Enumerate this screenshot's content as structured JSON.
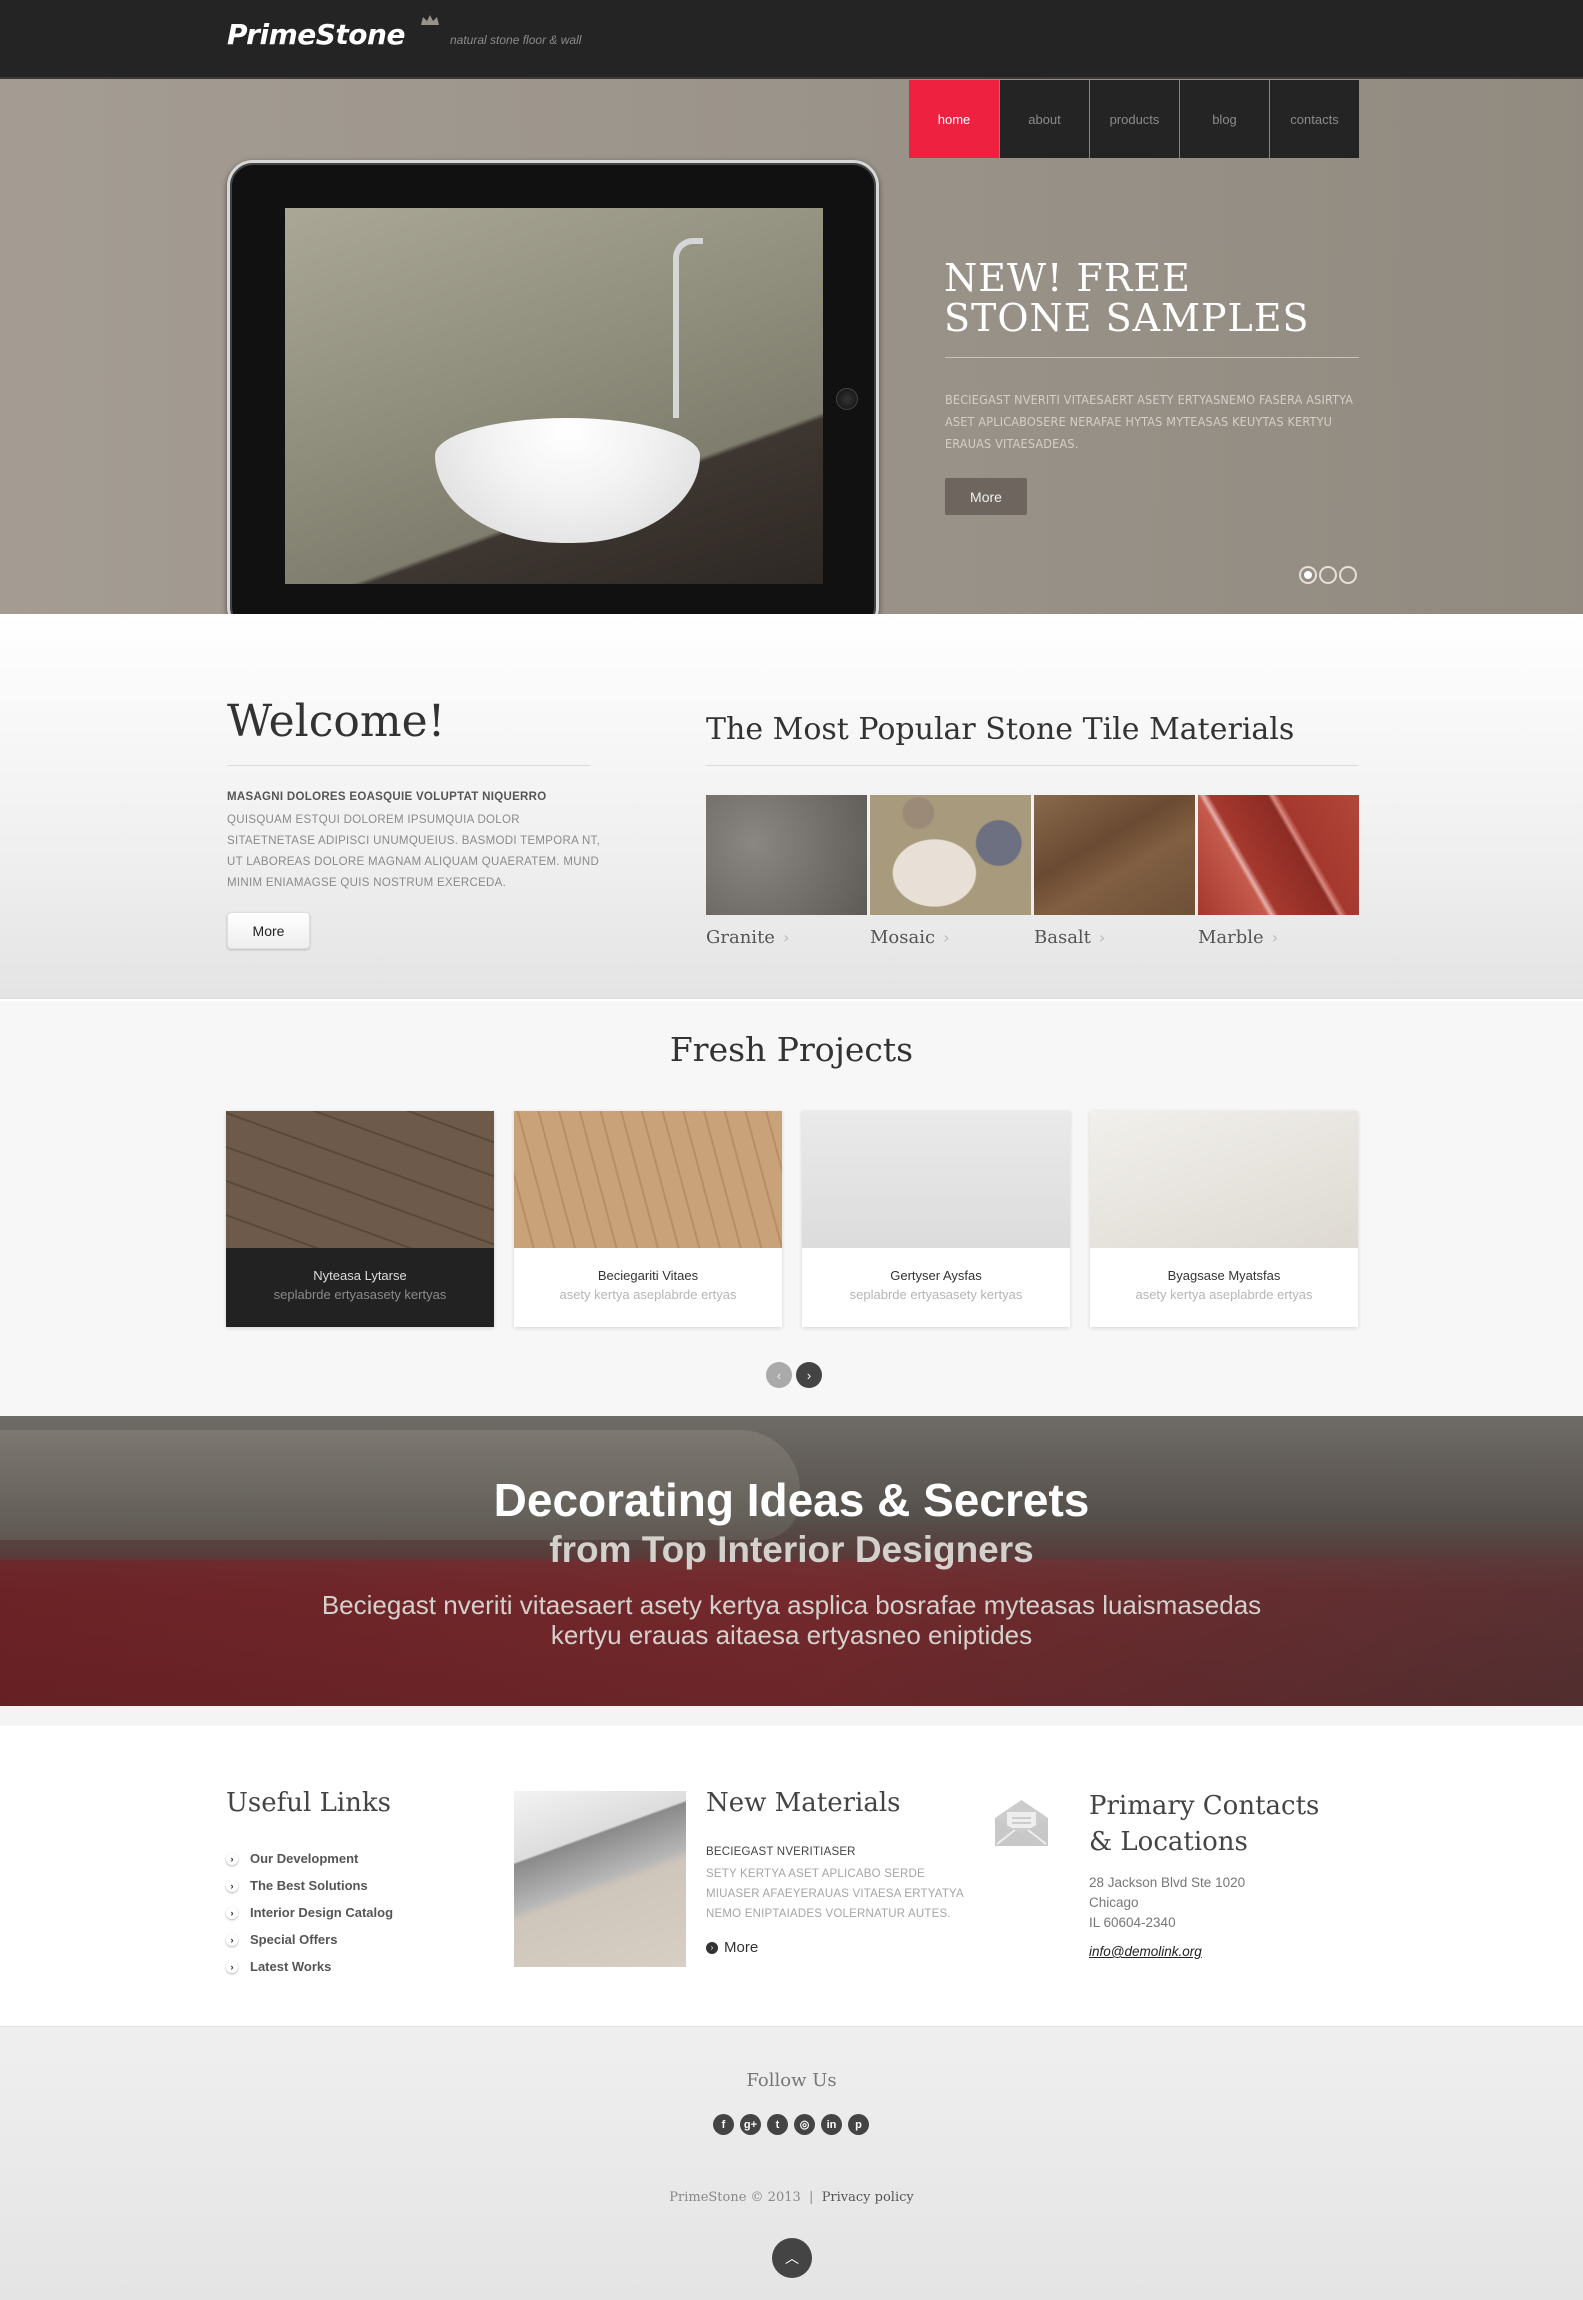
{
  "header": {
    "logo": "PrimeStone",
    "tagline": "natural stone floor & wall",
    "nav": [
      {
        "label": "home",
        "active": true
      },
      {
        "label": "about",
        "active": false
      },
      {
        "label": "products",
        "active": false
      },
      {
        "label": "blog",
        "active": false
      },
      {
        "label": "contacts",
        "active": false
      }
    ]
  },
  "hero": {
    "title_line1": "NEW! FREE",
    "title_line2": "STONE SAMPLES",
    "text": "BECIEGAST NVERITI VITAESAERT ASETY ERTYASNEMO FASERA ASIRTYA ASET APLICABOSERE NERAFAE HYTAS MYTEASAS KEUYTAS KERTYU ERAUAS VITAESADEAS.",
    "more_label": "More",
    "slides": 3,
    "active_slide": 1
  },
  "welcome": {
    "title": "Welcome!",
    "lead": "MASAGNI DOLORES EOASQUIE VOLUPTAT NIQUERRO",
    "text": "QUISQUAM ESTQUI DOLOREM IPSUMQUIA DOLOR SITAETNETASE ADIPISCI UNUMQUEIUS. BASMODI TEMPORA NT, UT LABOREAS DOLORE MAGNAM ALIQUAM QUAERATEM. MUND MINIM ENIAMAGSE QUIS NOSTRUM EXERCEDA.",
    "more_label": "More"
  },
  "materials": {
    "title": "The Most Popular Stone Tile Materials",
    "items": [
      {
        "label": "Granite",
        "color": "#6e6a66"
      },
      {
        "label": "Mosaic",
        "color": "#b7aa8e"
      },
      {
        "label": "Basalt",
        "color": "#7a5a3e"
      },
      {
        "label": "Marble",
        "color": "#a03a30"
      }
    ]
  },
  "projects": {
    "title": "Fresh Projects",
    "items": [
      {
        "name": "Nyteasa Lytarse",
        "sub": "seplabrde ertyasasety kertyas"
      },
      {
        "name": "Beciegariti Vitaes",
        "sub": "asety kertya aseplabrde ertyas"
      },
      {
        "name": "Gertyser Aysfas",
        "sub": "seplabrde ertyasasety kertyas"
      },
      {
        "name": "Byagsase Myatsfas",
        "sub": "asety kertya aseplabrde ertyas"
      }
    ],
    "prev_icon": "‹",
    "next_icon": "›"
  },
  "banner": {
    "title": "Decorating Ideas & Secrets",
    "subtitle": "from Top Interior Designers",
    "text_line1": "Beciegast nveriti vitaesaert asety kertya asplica bosrafae myteasas luaismasedas",
    "text_line2": "kertyu erauas aitaesa ertyasneo eniptides"
  },
  "useful_links": {
    "title": "Useful Links",
    "items": [
      "Our Development",
      "The Best Solutions",
      "Interior Design Catalog",
      "Special Offers",
      "Latest Works"
    ]
  },
  "new_materials": {
    "title": "New Materials",
    "lead": "BECIEGAST NVERITIASER",
    "text": "SETY KERTYA ASET APLICABO SERDE MIUASER AFAEYERAUAS VITAESA ERTYATYA NEMO ENIPTAIADES VOLERNATUR AUTES.",
    "more_label": "More"
  },
  "contacts": {
    "title_line1": "Primary Contacts",
    "title_line2": "& Locations",
    "address_line1": "28 Jackson Blvd Ste 1020",
    "address_line2": "Chicago",
    "address_line3": "IL 60604-2340",
    "email": "info@demolink.org"
  },
  "footer": {
    "follow_title": "Follow Us",
    "social": [
      {
        "name": "facebook",
        "glyph": "f"
      },
      {
        "name": "google-plus",
        "glyph": "g+"
      },
      {
        "name": "twitter",
        "glyph": "t"
      },
      {
        "name": "dribbble",
        "glyph": "◎"
      },
      {
        "name": "linkedin",
        "glyph": "in"
      },
      {
        "name": "pinterest",
        "glyph": "p"
      }
    ],
    "copyright": "PrimeStone © 2013",
    "separator": "|",
    "privacy_label": "Privacy policy",
    "to_top_icon": "︿"
  },
  "colors": {
    "accent": "#ef2140",
    "header_bg": "#242424",
    "hero_bg": "#8d857a"
  }
}
